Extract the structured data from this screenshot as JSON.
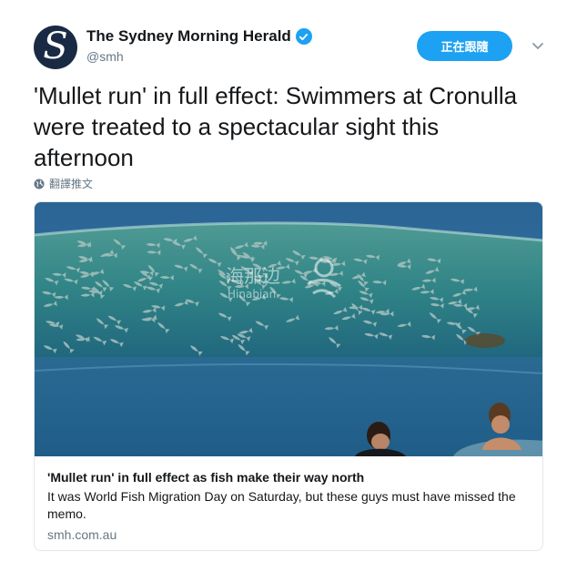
{
  "account": {
    "display_name": "The Sydney Morning Herald",
    "handle": "@smh",
    "avatar_letter": "S",
    "verified": true
  },
  "follow_button": {
    "label": "正在跟隨"
  },
  "tweet": {
    "text": "'Mullet run' in full effect: Swimmers at Cronulla were treated to a spectacular sight this afternoon",
    "translate_label": "翻譯推文"
  },
  "card": {
    "title": "'Mullet run' in full effect as fish make their way north",
    "description": "It was World Fish Migration Day on Saturday, but these guys must have missed the memo.",
    "domain": "smh.com.au",
    "watermark_cn": "海那边",
    "watermark_en": "Hinabian"
  },
  "colors": {
    "accent": "#1da1f2",
    "text_primary": "#14171a",
    "text_secondary": "#657786",
    "border": "#e1e8ed",
    "avatar_bg": "#1b2a44"
  }
}
